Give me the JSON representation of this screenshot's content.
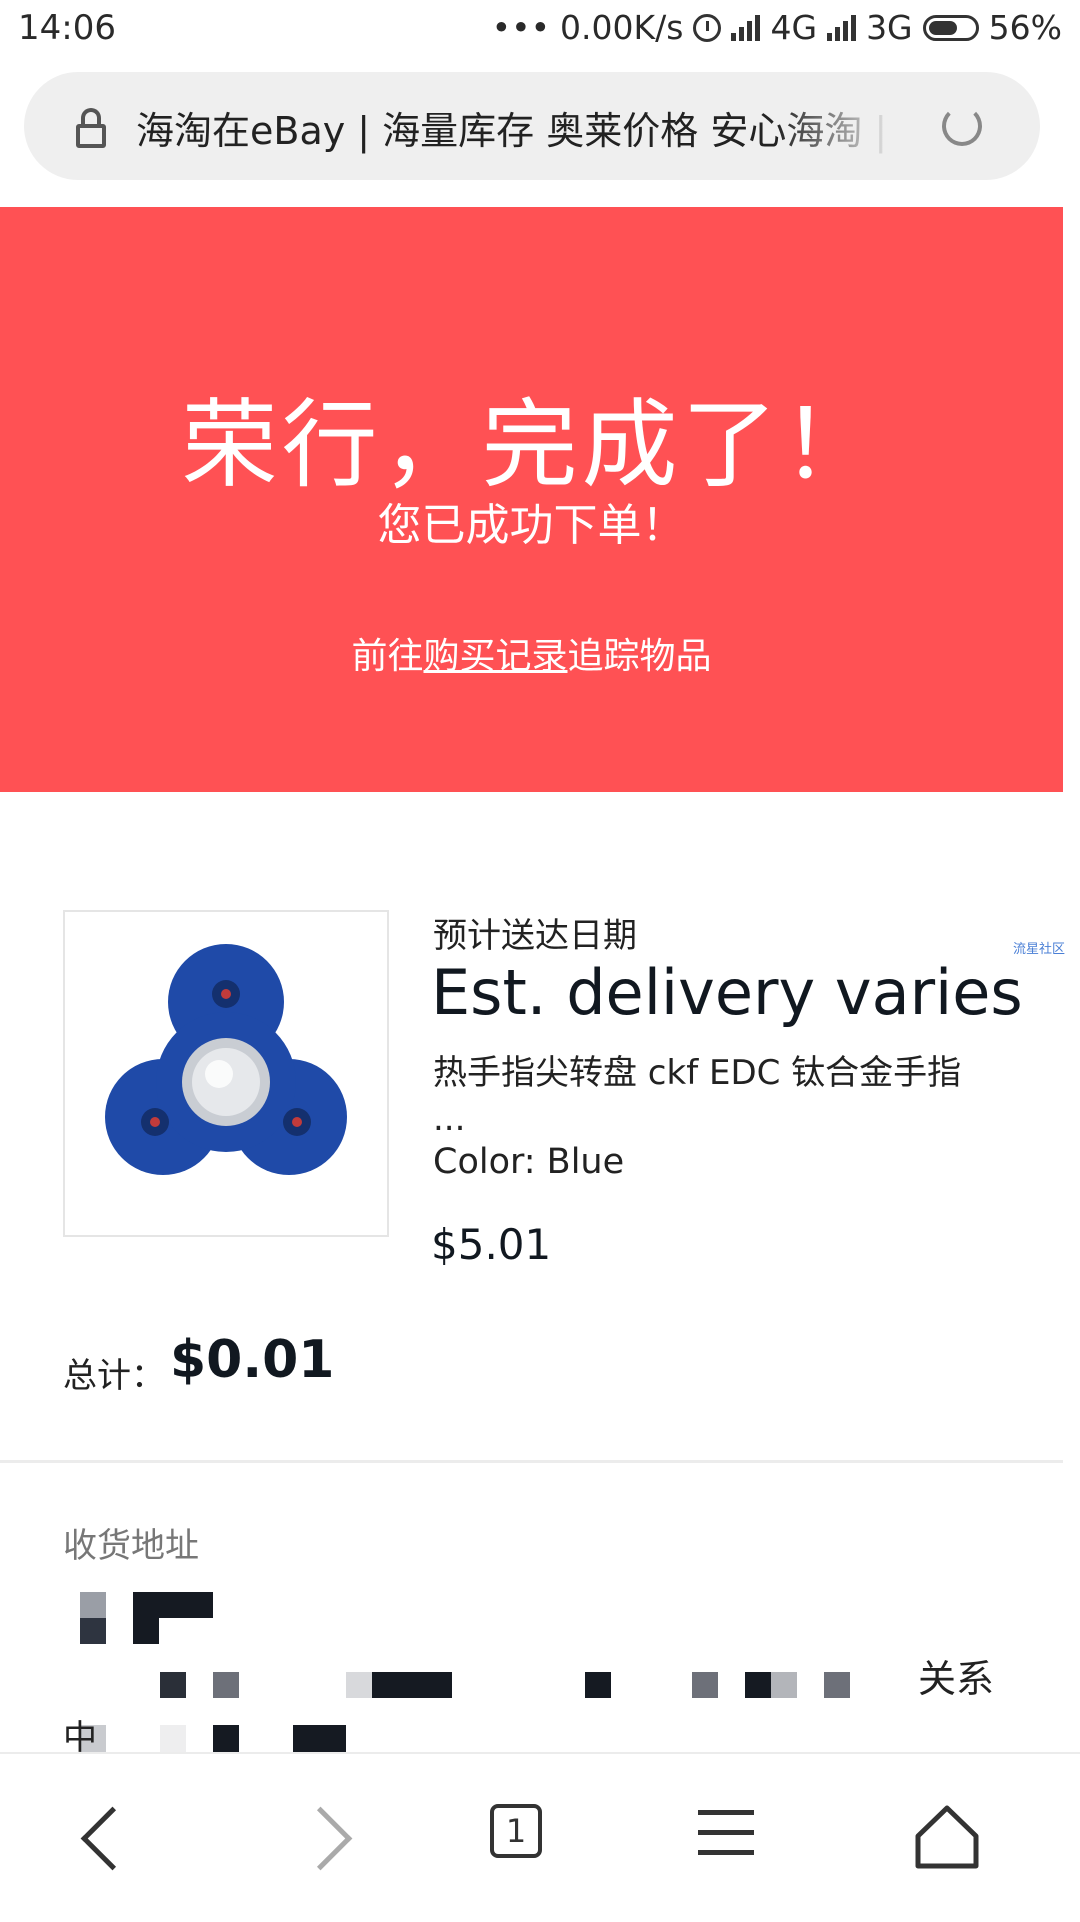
{
  "status_bar": {
    "time": "14:06",
    "network_speed": "0.00K/s",
    "net1": "4G",
    "net2": "3G",
    "battery": "56%"
  },
  "url_bar": {
    "title": "海淘在eBay | 海量库存 奥莱价格 安心海淘 |"
  },
  "hero": {
    "headline": "荣行，完成了！",
    "subline": "您已成功下单！",
    "track_prefix": "前往",
    "track_link": "购买记录",
    "track_suffix": "追踪物品",
    "background_color": "#ff5154"
  },
  "item": {
    "delivery_label": "预计送达日期",
    "delivery_value": "Est. delivery varies",
    "title": "热手指尖转盘 ckf EDC 钛合金手指 ...",
    "color": "Color: Blue",
    "price": "$5.01",
    "badge": "流星社区"
  },
  "total": {
    "label": "总计：",
    "value": "$0.01"
  },
  "address": {
    "label": "收货地址",
    "tail_text": "关系",
    "pre_text": "中"
  },
  "bottom_nav": {
    "tab_count": "1",
    "icons": [
      "back-icon",
      "forward-icon",
      "tabs-icon",
      "menu-icon",
      "home-icon"
    ]
  }
}
